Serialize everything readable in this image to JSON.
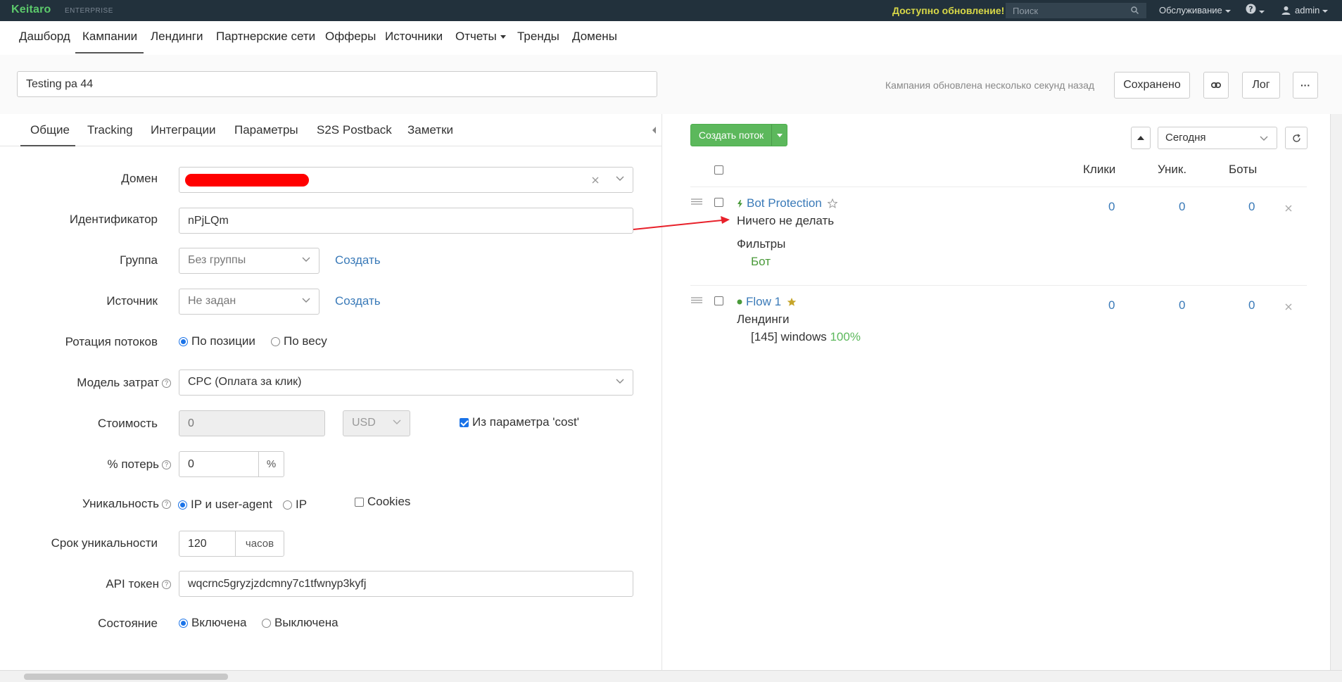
{
  "topbar": {
    "logo": "Keitaro",
    "logo_sub": "ENTERPRISE",
    "update_link": "Доступно обновление!",
    "search_placeholder": "Поиск",
    "service_menu": "Обслуживание",
    "user": "admin",
    "bg_color": "#22313c"
  },
  "nav": {
    "items": [
      {
        "label": "Дашборд"
      },
      {
        "label": "Кампании",
        "active": true
      },
      {
        "label": "Лендинги"
      },
      {
        "label": "Партнерские сети"
      },
      {
        "label": "Офферы"
      },
      {
        "label": "Источники"
      },
      {
        "label": "Отчеты"
      },
      {
        "label": "Тренды"
      },
      {
        "label": "Домены"
      }
    ]
  },
  "header": {
    "campaign_name": "Testing pa 44",
    "updated_text": "Кампания обновлена несколько секунд назад",
    "saved_label": "Сохранено",
    "log_label": "Лог",
    "more_label": "···"
  },
  "tabs": [
    {
      "label": "Общие",
      "active": true
    },
    {
      "label": "Tracking"
    },
    {
      "label": "Интеграции"
    },
    {
      "label": "Параметры"
    },
    {
      "label": "S2S Postback"
    },
    {
      "label": "Заметки"
    }
  ],
  "form": {
    "domain_label": "Домен",
    "domain_redacted_color": "#ff0000",
    "identifier_label": "Идентификатор",
    "identifier_value": "nPjLQm",
    "group_label": "Группа",
    "group_value": "Без группы",
    "group_create": "Создать",
    "source_label": "Источник",
    "source_value": "Не задан",
    "source_create": "Создать",
    "rotation_label": "Ротация потоков",
    "rotation_opt1": "По позиции",
    "rotation_opt2": "По весу",
    "cost_model_label": "Модель затрат",
    "cost_model_value": "CPC (Оплата за клик)",
    "cost_label": "Стоимость",
    "cost_value": "0",
    "currency_value": "USD",
    "cost_param_label": "Из параметра 'cost'",
    "loss_label": "% потерь",
    "loss_value": "0",
    "loss_addon": "%",
    "uniq_label": "Уникальность",
    "uniq_opt1": "IP и user-agent",
    "uniq_opt2": "IP",
    "uniq_cookies": "Cookies",
    "uniq_term_label": "Срок уникальности",
    "uniq_term_value": "120",
    "uniq_term_addon": "часов",
    "api_label": "API токен",
    "api_value": "wqcrnc5gryzjzdcmny7c1tfwnyp3kyfj",
    "state_label": "Состояние",
    "state_opt1": "Включена",
    "state_opt2": "Выключена"
  },
  "flows_panel": {
    "create_flow": "Создать поток",
    "date_range": "Сегодня",
    "columns": [
      "Клики",
      "Уник.",
      "Боты"
    ],
    "flows": [
      {
        "name": "Bot Protection",
        "action": "Ничего не делать",
        "sub_heading": "Фильтры",
        "sub_item": "Бот",
        "clicks": "0",
        "uniq": "0",
        "bots": "0"
      },
      {
        "name": "Flow 1",
        "action": "Лендинги",
        "sub_item": "[145] windows",
        "sub_percent": "100%",
        "clicks": "0",
        "uniq": "0",
        "bots": "0"
      }
    ],
    "accent_green": "#5cb85c",
    "link_blue": "#3a7ab8"
  }
}
